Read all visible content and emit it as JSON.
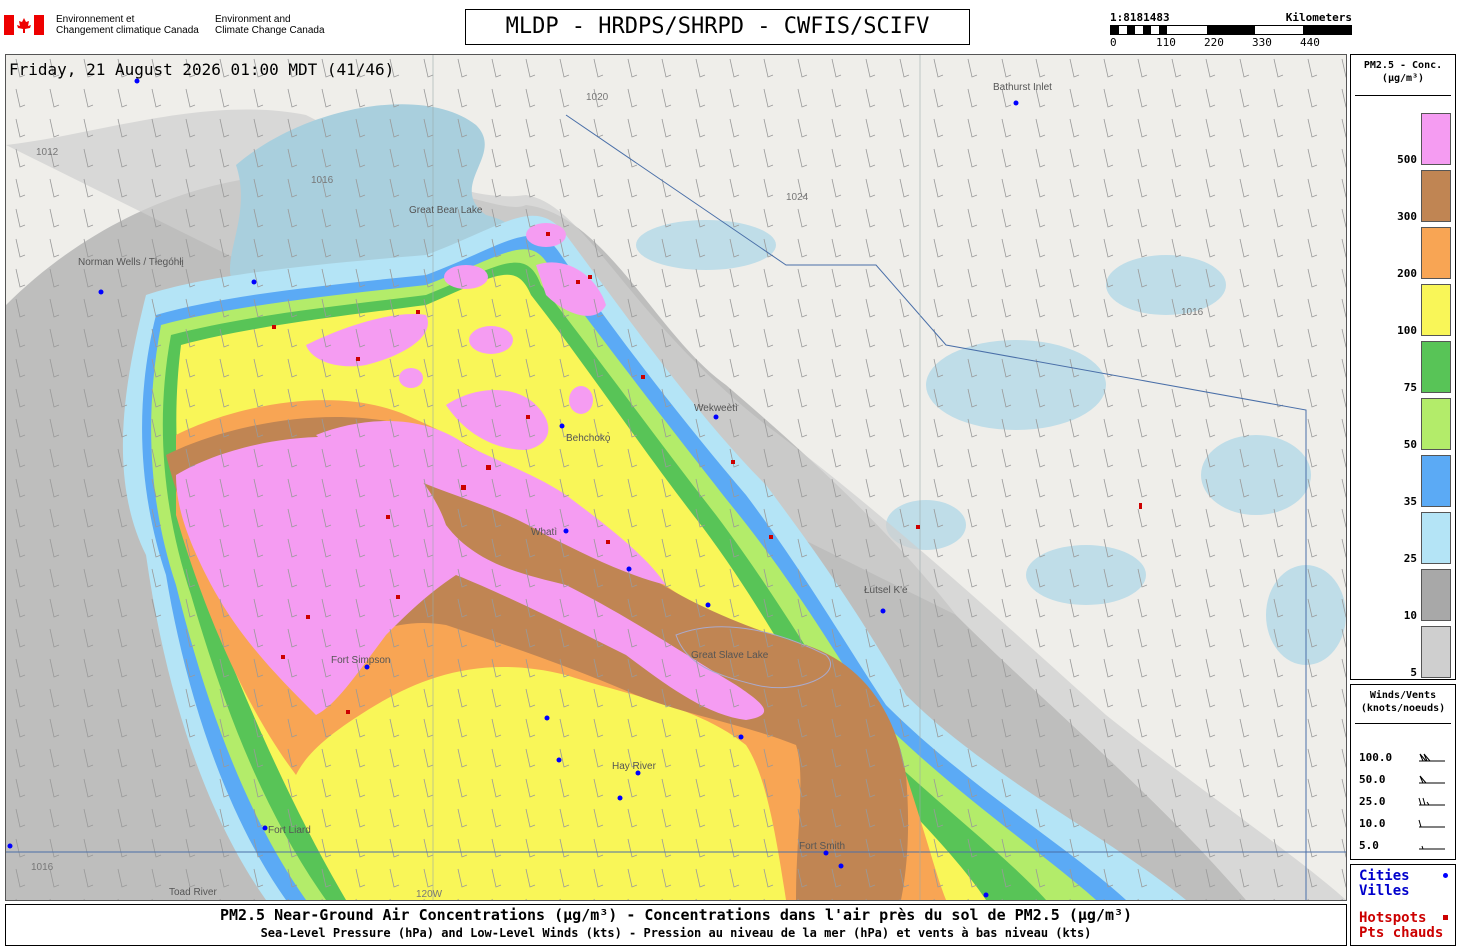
{
  "header": {
    "agency_fr": "Environnement et\nChangement climatique Canada",
    "agency_en": "Environment and\nClimate Change Canada",
    "title": "MLDP - HRDPS/SHRPD - CWFIS/SCIFV",
    "scale_ratio": "1:8181483",
    "scale_unit": "Kilometers",
    "scale_ticks": [
      "0",
      "110",
      "220",
      "330",
      "440"
    ]
  },
  "map": {
    "timestamp": "Friday, 21 August 2026 01:00 MDT (41/46)",
    "cities": [
      "Bathurst Inlet",
      "Norman Wells / Tłegóhłį",
      "Wekweètì",
      "Whatì",
      "Łutsel K'e",
      "Hay River",
      "Fort Smith",
      "Fort Liard",
      "Toad River",
      "Great Bear Lake",
      "Great Slave Lake",
      "Behchokǫ̀",
      "Fort Simpson"
    ],
    "isobars": [
      "1012",
      "1016",
      "1020",
      "1024"
    ],
    "meridian_label": "120W"
  },
  "legend_concentration": {
    "title": "PM2.5 - Conc.\n(µg/m³)",
    "levels": [
      {
        "label": "500",
        "color": "#f59cf2"
      },
      {
        "label": "300",
        "color": "#c08553"
      },
      {
        "label": "200",
        "color": "#f8a554"
      },
      {
        "label": "100",
        "color": "#f9f658"
      },
      {
        "label": "75",
        "color": "#58c457"
      },
      {
        "label": "50",
        "color": "#b3ec6a"
      },
      {
        "label": "35",
        "color": "#5baaf5"
      },
      {
        "label": "25",
        "color": "#b4e4f6"
      },
      {
        "label": "10",
        "color": "#a8a8a8"
      },
      {
        "label": "5",
        "color": "#cfcfcf"
      }
    ]
  },
  "legend_winds": {
    "title": "Winds/Vents\n(knots/noeuds)",
    "speeds": [
      "100.0",
      "50.0",
      "25.0",
      "10.0",
      "5.0"
    ]
  },
  "legend_markers": {
    "cities": "Cities",
    "villes": "Villes",
    "hotspots": "Hotspots",
    "pts_chauds": "Pts chauds",
    "city_color": "#0000ff",
    "hotspot_color": "#cc0000"
  },
  "footer": {
    "line1": "PM2.5 Near-Ground Air Concentrations (µg/m³) - Concentrations dans l'air près du sol de PM2.5 (µg/m³)",
    "line2": "Sea-Level Pressure (hPa) and Low-Level Winds (kts) - Pression au niveau de la mer (hPa) et vents à bas niveau (kts)"
  }
}
